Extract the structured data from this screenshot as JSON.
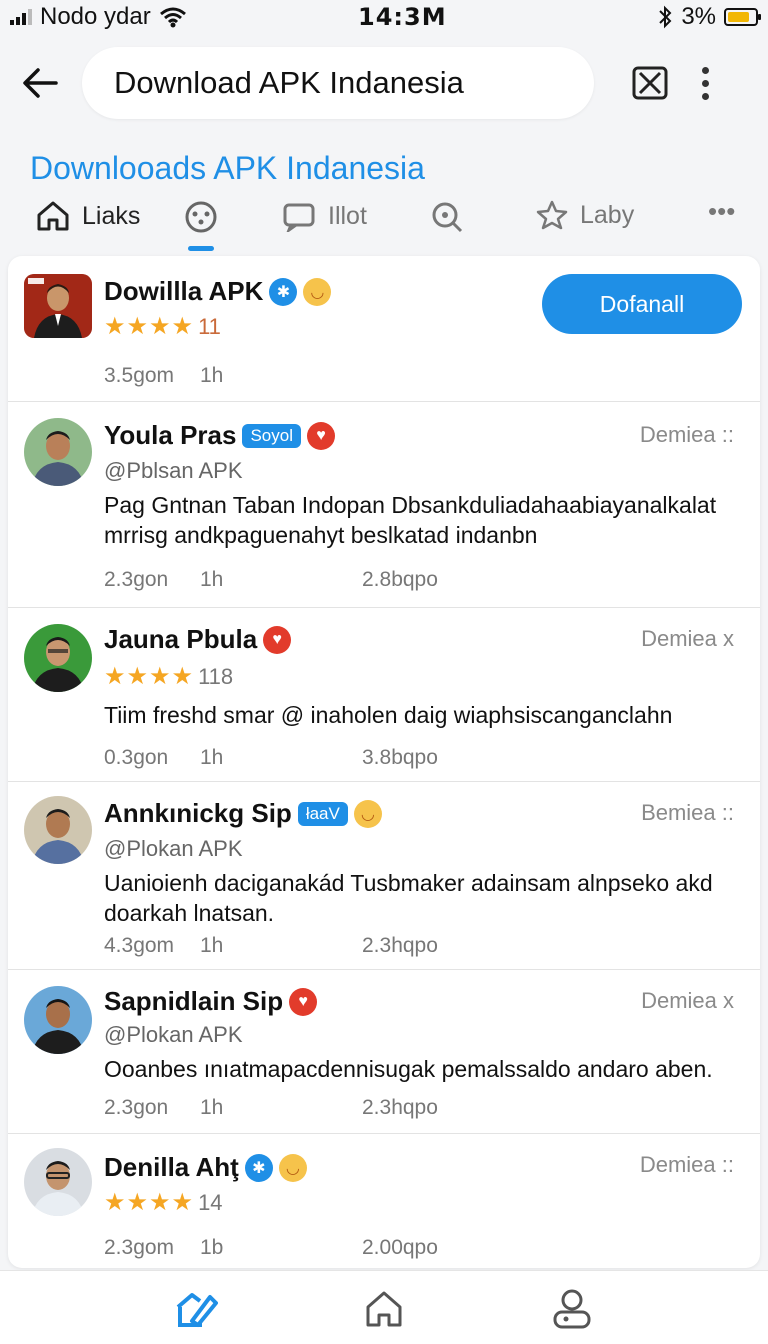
{
  "status_bar": {
    "carrier": "Nodo ydar",
    "time": "14:3M",
    "battery": "3%",
    "battery_level": 0.8
  },
  "search": {
    "value": "Download APK Indanesia"
  },
  "page": {
    "title": "Downlooads APK Indanesia"
  },
  "tabs": [
    {
      "label": "Liaks",
      "icon": "home-icon"
    },
    {
      "label": "",
      "icon": "face-icon"
    },
    {
      "label": "Illot",
      "icon": "chat-icon"
    },
    {
      "label": "",
      "icon": "search-icon"
    },
    {
      "label": "Laby",
      "icon": "star-icon"
    }
  ],
  "feed": {
    "app_card": {
      "name": "Dowillla APK",
      "rating_count": "11",
      "download_label": "Dofanall",
      "meta_size": "3.5gom",
      "meta_time": "1h"
    },
    "posts": [
      {
        "name": "Youla Pras",
        "badge": "Soyol",
        "handle": "@Pblsan APK",
        "follow": "Demiea ::",
        "text": "Pag Gntnan Taban Indopan Dbsankduliadahaabiayanalkalat mrrisg andkpaguenahyt beslkatad indanbn",
        "meta_size": "2.3gon",
        "meta_time": "1h",
        "meta_views": "2.8bqpo"
      },
      {
        "name": "Jauna Pbula",
        "rating_count": "118",
        "follow": "Demiea x",
        "text": "Tiim freshd smar @ inaholen daig wiaphsiscanganclahn",
        "meta_size": "0.3gon",
        "meta_time": "1h",
        "meta_views": "3.8bqpo"
      },
      {
        "name": "Annkınickg Sip",
        "badge": "łaaV",
        "handle": "@Plokan APK",
        "follow": "Bemiea ::",
        "text": "Uanioienh daciganakád Tusbmaker adainsam alnpseko akd doarkah lnatsan.",
        "meta_size": "4.3gom",
        "meta_time": "1h",
        "meta_views": "2.3hqpo"
      },
      {
        "name": "Sapnidlain Sip",
        "handle": "@Plokan APK",
        "follow": "Demiea x",
        "text": "Ooanbes ınıatmapacdennisugak pemalssaldo andaro aben.",
        "meta_size": "2.3gon",
        "meta_time": "1h",
        "meta_views": "2.3hqpo"
      },
      {
        "name": "Denilla Ahţ",
        "rating_count": "14",
        "follow": "Demiea ::",
        "meta_size": "2.3gom",
        "meta_time": "1b",
        "meta_views": "2.00qpo"
      }
    ]
  },
  "colors": {
    "accent": "#1f8fe6",
    "star": "#f5a623",
    "badge_red": "#e23b2b"
  }
}
